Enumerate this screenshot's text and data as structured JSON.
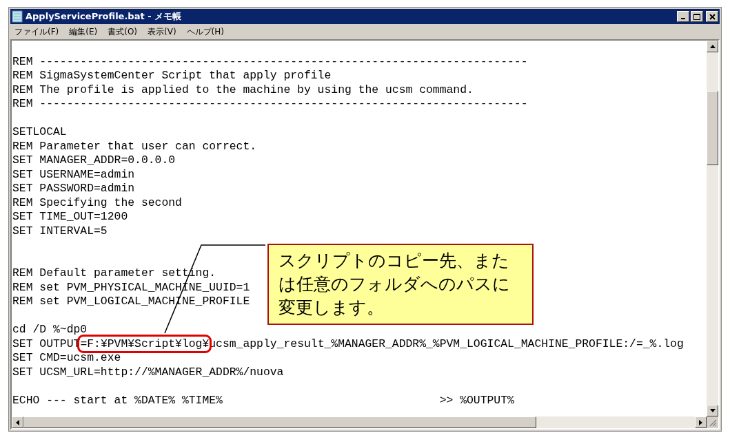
{
  "window": {
    "title": "ApplyServiceProfile.bat - メモ帳"
  },
  "menu": [
    "ファイル(F)",
    "編集(E)",
    "書式(O)",
    "表示(V)",
    "ヘルプ(H)"
  ],
  "lines": [
    {
      "kind": "blank"
    },
    {
      "kind": "text",
      "text": "REM ------------------------------------------------------------------------"
    },
    {
      "kind": "text",
      "text": "REM SigmaSystemCenter Script that apply profile"
    },
    {
      "kind": "text",
      "text": "REM The profile is applied to the machine by using the ucsm command."
    },
    {
      "kind": "text",
      "text": "REM ------------------------------------------------------------------------"
    },
    {
      "kind": "blank"
    },
    {
      "kind": "text",
      "text": "SETLOCAL"
    },
    {
      "kind": "text",
      "text": "REM Parameter that user can correct."
    },
    {
      "kind": "text",
      "text": "SET MANAGER_ADDR=0.0.0.0"
    },
    {
      "kind": "text",
      "text": "SET USERNAME=admin"
    },
    {
      "kind": "text",
      "text": "SET PASSWORD=admin"
    },
    {
      "kind": "text",
      "text": "REM Specifying the second"
    },
    {
      "kind": "text",
      "text": "SET TIME_OUT=1200"
    },
    {
      "kind": "text",
      "text": "SET INTERVAL=5"
    },
    {
      "kind": "blank"
    },
    {
      "kind": "blank"
    },
    {
      "kind": "text",
      "text": "REM Default parameter setting."
    },
    {
      "kind": "text",
      "text": "REM set PVM_PHYSICAL_MACHINE_UUID=1"
    },
    {
      "kind": "text",
      "text": "REM set PVM_LOGICAL_MACHINE_PROFILE"
    },
    {
      "kind": "blank"
    },
    {
      "kind": "text",
      "text": "cd /D %~dp0"
    },
    {
      "kind": "marked",
      "before": "SET OUTPUT",
      "marked": "=F:¥PVM¥Script¥log¥",
      "after": "ucsm_apply_result_%MANAGER_ADDR%_%PVM_LOGICAL_MACHINE_PROFILE:/=_%.log"
    },
    {
      "kind": "text",
      "text": "SET CMD=ucsm.exe"
    },
    {
      "kind": "text",
      "text": "SET UCSM_URL=http://%MANAGER_ADDR%/nuova"
    },
    {
      "kind": "blank"
    },
    {
      "kind": "text",
      "text": "ECHO --- start at %DATE% %TIME%                                >> %OUTPUT%"
    }
  ],
  "callout": {
    "text": "スクリプトのコピー先、または任意のフォルダへのパスに変更します。"
  }
}
